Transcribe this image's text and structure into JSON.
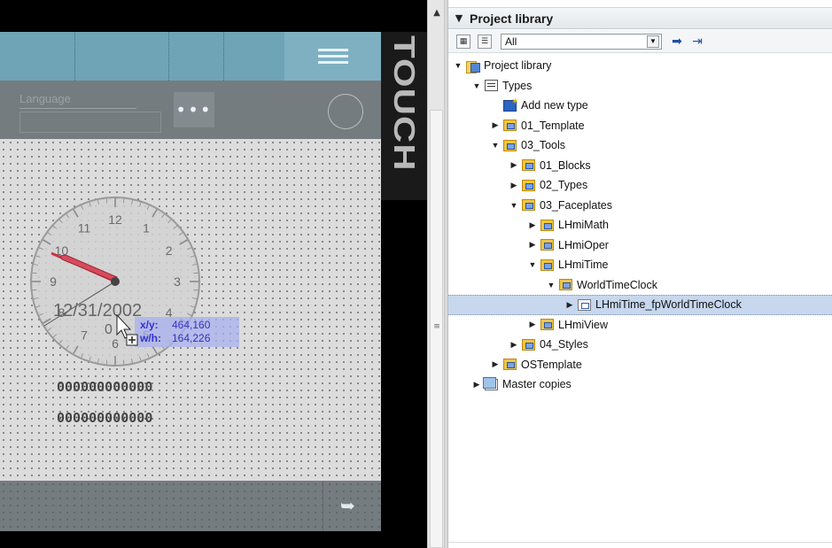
{
  "editor": {
    "language_label": "Language",
    "dots_label": "•••",
    "touch_label": "TOUCH",
    "clock_numbers": [
      "12",
      "1",
      "2",
      "3",
      "4",
      "5",
      "6",
      "7",
      "8",
      "9",
      "10",
      "11"
    ],
    "date_text": "12/31/2002",
    "time_text": "0",
    "coords": {
      "xy_label": "x/y:",
      "xy_value": "464,160",
      "wh_label": "w/h:",
      "wh_value": "164,226"
    },
    "counter_1": "000000000000",
    "counter_2": "000000000000",
    "colors": {
      "header": "#6fa3b6",
      "bar": "#757c80",
      "canvas": "#dcdcdc",
      "hour_hand": "#d94a5c"
    }
  },
  "splitter": {
    "up_icon": "chevron-up-icon",
    "grip_icon": "grip-icon"
  },
  "library": {
    "title": "Project library",
    "filter_value": "All",
    "tree": [
      {
        "label": "Project library",
        "level": 0,
        "toggle": "▼",
        "icon": "lib"
      },
      {
        "label": "Types",
        "level": 1,
        "toggle": "▼",
        "icon": "types"
      },
      {
        "label": "Add new type",
        "level": 2,
        "toggle": "",
        "icon": "add"
      },
      {
        "label": "01_Template",
        "level": 2,
        "toggle": "▶",
        "icon": "folder-type"
      },
      {
        "label": "03_Tools",
        "level": 2,
        "toggle": "▼",
        "icon": "folder-type"
      },
      {
        "label": "01_Blocks",
        "level": 3,
        "toggle": "▶",
        "icon": "folder-type"
      },
      {
        "label": "02_Types",
        "level": 3,
        "toggle": "▶",
        "icon": "folder-type"
      },
      {
        "label": "03_Faceplates",
        "level": 3,
        "toggle": "▼",
        "icon": "folder-type"
      },
      {
        "label": "LHmiMath",
        "level": 4,
        "toggle": "▶",
        "icon": "folder-type"
      },
      {
        "label": "LHmiOper",
        "level": 4,
        "toggle": "▶",
        "icon": "folder-type"
      },
      {
        "label": "LHmiTime",
        "level": 4,
        "toggle": "▼",
        "icon": "folder-type"
      },
      {
        "label": "WorldTimeClock",
        "level": 5,
        "toggle": "▼",
        "icon": "folder-type"
      },
      {
        "label": "LHmiTime_fpWorldTimeClock",
        "level": 6,
        "toggle": "▶",
        "icon": "face",
        "selected": true
      },
      {
        "label": "LHmiView",
        "level": 4,
        "toggle": "▶",
        "icon": "folder-type"
      },
      {
        "label": "04_Styles",
        "level": 3,
        "toggle": "▶",
        "icon": "folder-type"
      },
      {
        "label": "OSTemplate",
        "level": 2,
        "toggle": "▶",
        "icon": "folder-type"
      },
      {
        "label": "Master copies",
        "level": 1,
        "toggle": "▶",
        "icon": "master"
      }
    ]
  }
}
